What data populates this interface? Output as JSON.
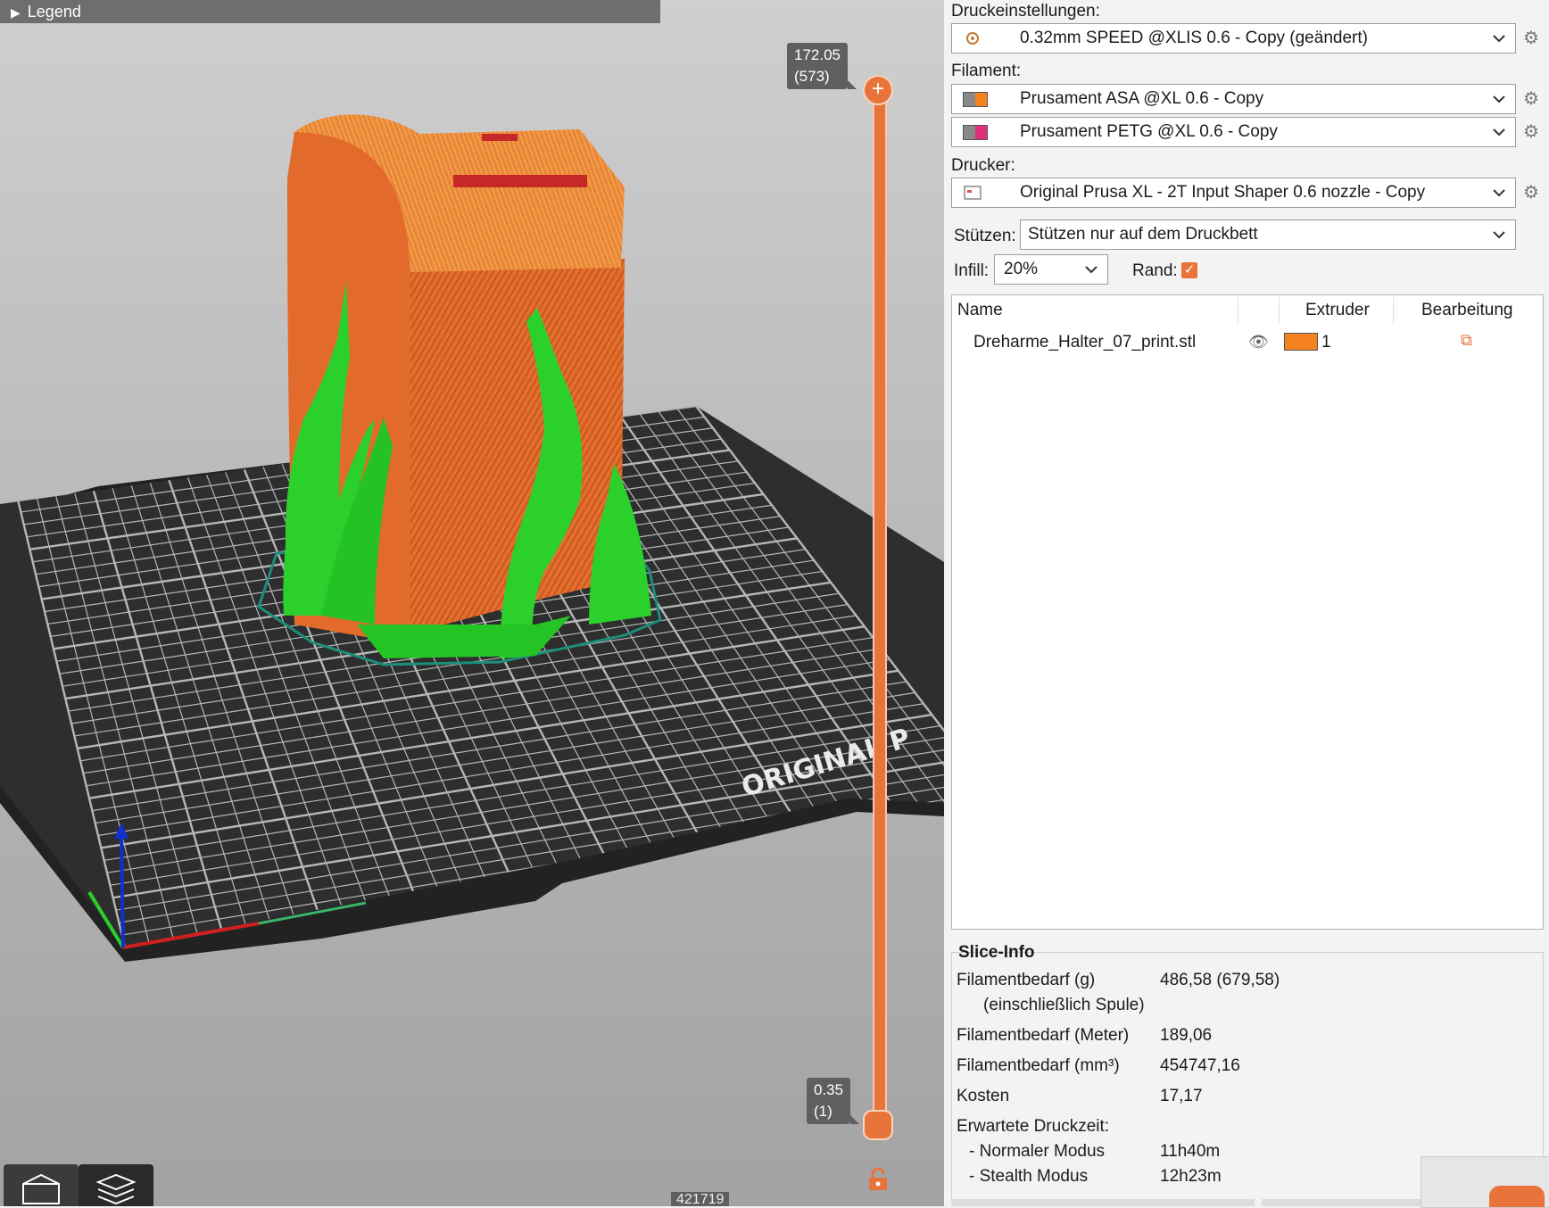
{
  "viewport": {
    "legend_label": "Legend",
    "top_layer": {
      "height": "172.05",
      "layer": "(573)"
    },
    "bottom_layer": {
      "height": "0.35",
      "layer": "(1)"
    },
    "bed_logo_text": "ORIGINAL P",
    "move_counter": "421719",
    "colors": {
      "part": "#e8743b",
      "support": "#2bd02b",
      "bed": "#2d2d2d",
      "grid": "#d8d8d8"
    }
  },
  "panel": {
    "print_settings_label": "Druckeinstellungen:",
    "print_profile": "0.32mm SPEED @XLIS 0.6 - Copy (geändert)",
    "filament_label": "Filament:",
    "filaments": [
      {
        "name": "Prusament ASA @XL 0.6 - Copy",
        "color": "#f58220"
      },
      {
        "name": "Prusament PETG @XL 0.6 - Copy",
        "color": "#e0307a"
      }
    ],
    "printer_label": "Drucker:",
    "printer_profile": "Original Prusa XL - 2T Input Shaper 0.6 nozzle - Copy",
    "supports_label": "Stützen:",
    "supports_value": "Stützen nur auf dem Druckbett",
    "infill_label": "Infill:",
    "infill_value": "20%",
    "brim_label": "Rand:",
    "brim_checked": true,
    "objects": {
      "headers": {
        "name": "Name",
        "extruder": "Extruder",
        "editing": "Bearbeitung"
      },
      "rows": [
        {
          "name": "Dreharme_Halter_07_print.stl",
          "extruder": "1",
          "color": "#f58220"
        }
      ]
    },
    "slice_info": {
      "title": "Slice-Info",
      "filament_g_label": "Filamentbedarf (g)",
      "filament_g_sub": "(einschließlich Spule)",
      "filament_g_value": "486,58 (679,58)",
      "filament_m_label": "Filamentbedarf (Meter)",
      "filament_m_value": "189,06",
      "filament_mm3_label": "Filamentbedarf (mm³)",
      "filament_mm3_value": "454747,16",
      "cost_label": "Kosten",
      "cost_value": "17,17",
      "time_label": "Erwartete Druckzeit:",
      "normal_label": "- Normaler Modus",
      "normal_value": "11h40m",
      "stealth_label": "- Stealth Modus",
      "stealth_value": "12h23m"
    }
  }
}
